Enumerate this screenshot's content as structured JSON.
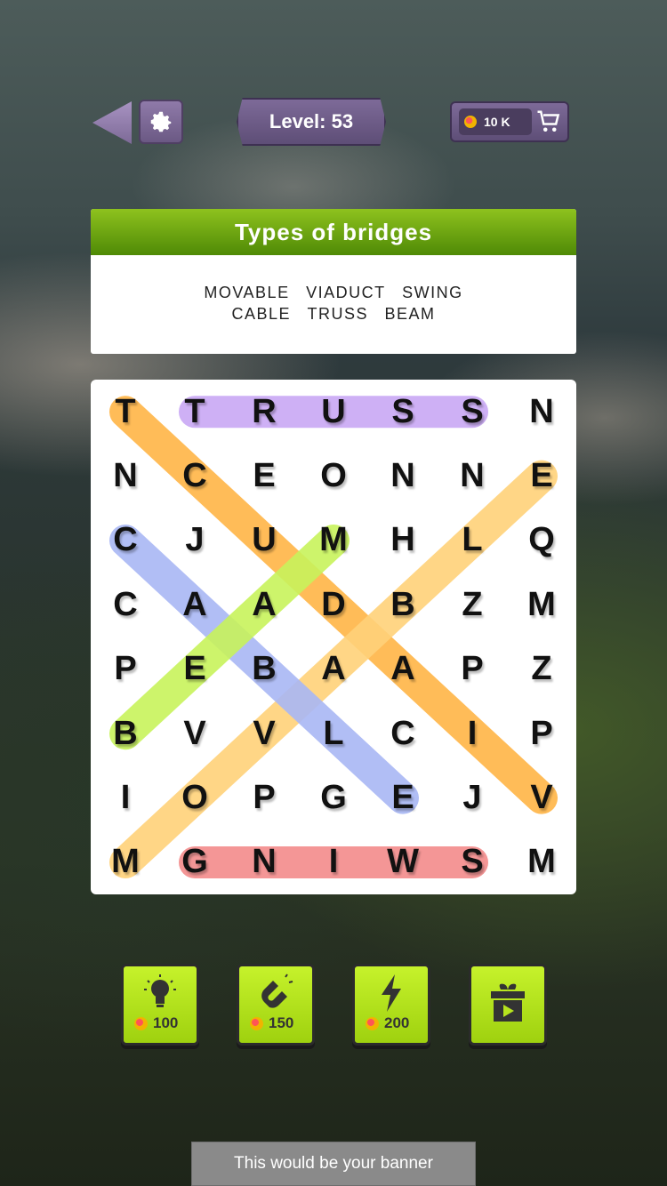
{
  "topbar": {
    "level_label": "Level: 53",
    "coins": "10 K",
    "icons": [
      "back-arrow-icon",
      "gear-icon",
      "coin-icon",
      "cart-icon"
    ]
  },
  "category": {
    "title": "Types of bridges",
    "words": [
      "MOVABLE",
      "VIADUCT",
      "SWING",
      "CABLE",
      "TRUSS",
      "BEAM"
    ]
  },
  "grid": {
    "rows": [
      [
        "T",
        "T",
        "R",
        "U",
        "S",
        "S",
        "N"
      ],
      [
        "N",
        "C",
        "E",
        "O",
        "N",
        "N",
        "E"
      ],
      [
        "C",
        "J",
        "U",
        "M",
        "H",
        "L",
        "Q"
      ],
      [
        "C",
        "A",
        "A",
        "D",
        "B",
        "Z",
        "M"
      ],
      [
        "P",
        "E",
        "B",
        "A",
        "A",
        "P",
        "Z"
      ],
      [
        "B",
        "V",
        "V",
        "L",
        "C",
        "I",
        "P"
      ],
      [
        "I",
        "O",
        "P",
        "G",
        "E",
        "J",
        "V"
      ],
      [
        "M",
        "G",
        "N",
        "I",
        "W",
        "S",
        "M"
      ]
    ],
    "found": [
      {
        "word": "TRUSS",
        "color": "#c9a8f5"
      },
      {
        "word": "SWING",
        "color": "#f38b8b"
      },
      {
        "word": "VIADUCT",
        "color": "#ffb547"
      },
      {
        "word": "MOVABLE",
        "color": "#ffd27a"
      },
      {
        "word": "CABLE",
        "color": "#a9b7f5"
      },
      {
        "word": "BEAM",
        "color": "#c8f35c"
      }
    ]
  },
  "boosters": [
    {
      "name": "hint",
      "icon": "lightbulb-icon",
      "price": "100"
    },
    {
      "name": "magnet",
      "icon": "magnet-icon",
      "price": "150"
    },
    {
      "name": "lightning",
      "icon": "lightning-icon",
      "price": "200"
    },
    {
      "name": "free-gift",
      "icon": "gift-video-icon",
      "price": ""
    }
  ],
  "banner": {
    "text": "This would be your banner"
  },
  "colors": {
    "accent_green": "#9fd10f",
    "panel_purple": "#6b5984"
  }
}
